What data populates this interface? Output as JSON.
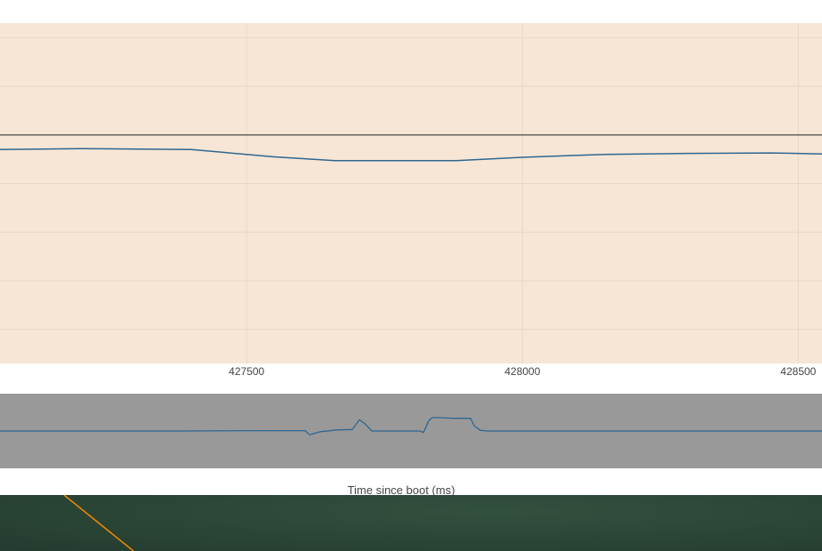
{
  "chart_data": {
    "type": "line",
    "xlabel": "Time since boot (ms)",
    "ylabel": "",
    "title": "",
    "xlim": [
      427053,
      428543
    ],
    "ylim": [
      0,
      7
    ],
    "x_ticks": [
      427500,
      428000,
      428500
    ],
    "x_tick_labels": [
      "427500",
      "428000",
      "428500"
    ],
    "y_gridlines": [
      0.7,
      1.7,
      2.7,
      3.7,
      4.7,
      5.7,
      6.7
    ],
    "reference_line": 4.7,
    "grid": true,
    "plot_background": "#f7e6d5",
    "series": [
      {
        "color": "#2e6690",
        "x": [
          427053,
          427200,
          427400,
          427550,
          427660,
          427750,
          427880,
          428000,
          428150,
          428300,
          428450,
          428543
        ],
        "y": [
          4.4,
          4.42,
          4.4,
          4.25,
          4.17,
          4.17,
          4.17,
          4.24,
          4.3,
          4.32,
          4.33,
          4.31
        ]
      }
    ],
    "range_slider": {
      "background": "#999999",
      "xlim": [
        0,
        924
      ],
      "ylim": [
        0,
        10
      ],
      "series": [
        {
          "color": "#2e6690",
          "x": [
            0,
            100,
            200,
            300,
            343,
            348,
            360,
            380,
            396,
            404,
            410,
            418,
            440,
            472,
            476,
            482,
            486,
            492,
            510,
            529,
            533,
            540,
            548,
            600,
            700,
            800,
            924
          ],
          "y": [
            5.0,
            5.0,
            5.0,
            5.05,
            5.05,
            4.5,
            4.9,
            5.15,
            5.2,
            6.5,
            6.0,
            5.0,
            5.0,
            5.0,
            4.8,
            6.4,
            6.8,
            6.8,
            6.7,
            6.7,
            5.7,
            5.1,
            5.0,
            5.0,
            5.0,
            5.0,
            5.0
          ]
        }
      ]
    }
  },
  "video_overlay": {
    "line_color": "#f08a00"
  }
}
